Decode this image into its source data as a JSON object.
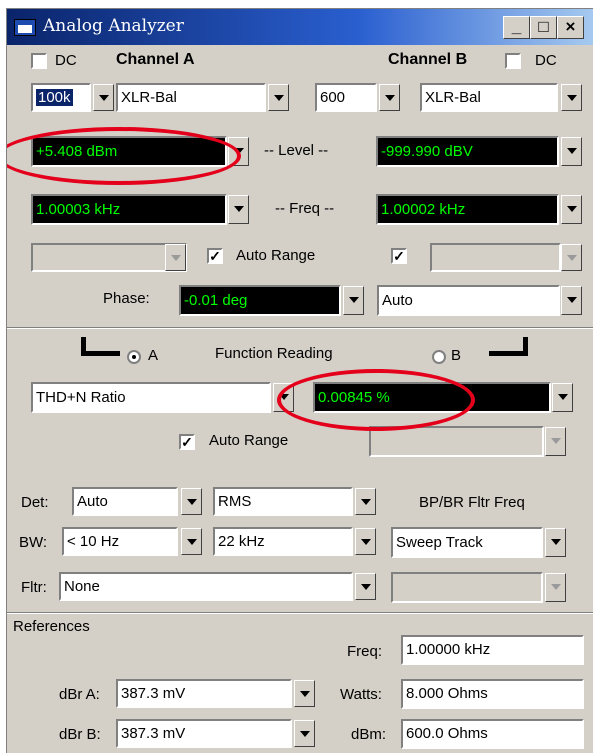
{
  "window": {
    "title": "Analog Analyzer",
    "minimize": "_",
    "maximize": "□",
    "close": "×"
  },
  "channels": {
    "dc_label": "DC",
    "channel_a": "Channel A",
    "channel_b": "Channel B",
    "a": {
      "impedance": "100k",
      "input_type": "XLR-Bal",
      "level": "+5.408  dBm",
      "freq": "1.00003 kHz"
    },
    "b": {
      "impedance": "600",
      "input_type": "XLR-Bal",
      "level": "-999.990 dBV",
      "freq": "1.00002 kHz"
    },
    "level_label": "-- Level --",
    "freq_label": "-- Freq --",
    "auto_range_label": "Auto Range",
    "phase_label": "Phase:",
    "phase_value": "-0.01   deg",
    "phase_mode": "Auto"
  },
  "function": {
    "a_label": "A",
    "b_label": "B",
    "title": "Function Reading",
    "type": "THD+N Ratio",
    "reading": "0.00845  %",
    "auto_range_label": "Auto Range"
  },
  "detector": {
    "det_label": "Det:",
    "det_value": "Auto",
    "det_mode": "RMS",
    "bw_label": "BW:",
    "bw_low": "< 10 Hz",
    "bw_high": "22 kHz",
    "fltr_label": "Fltr:",
    "fltr_value": "None",
    "bpbr_label": "BP/BR Fltr Freq",
    "bpbr_value": "Sweep Track"
  },
  "references": {
    "title": "References",
    "dbra_label": "dBr A:",
    "dbra_value": "387.3   mV",
    "dbrb_label": "dBr B:",
    "dbrb_value": "387.3   mV",
    "freq_label": "Freq:",
    "freq_value": "1.00000 kHz",
    "watts_label": "Watts:",
    "watts_value": "8.000    Ohms",
    "dbm_label": "dBm:",
    "dbm_value": "600.0    Ohms"
  },
  "colors": {
    "window_bg": "#d4d0c8",
    "display_bg": "#000000",
    "display_text": "#00ff00",
    "highlight_ellipse": "#e4001b",
    "titlebar": "#0a246a"
  }
}
